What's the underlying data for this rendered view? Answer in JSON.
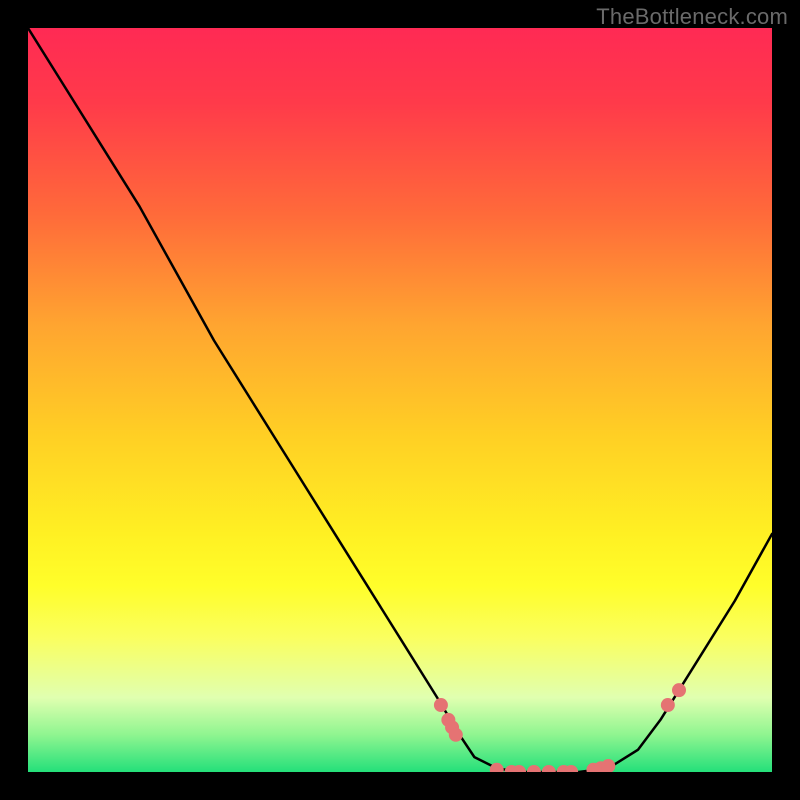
{
  "watermark": "TheBottleneck.com",
  "chart_data": {
    "type": "line",
    "title": "",
    "xlabel": "",
    "ylabel": "",
    "xlim": [
      0,
      100
    ],
    "ylim": [
      0,
      100
    ],
    "series": [
      {
        "name": "bottleneck-curve",
        "x": [
          0,
          5,
          10,
          15,
          20,
          25,
          30,
          35,
          40,
          45,
          50,
          55,
          58,
          60,
          63,
          66,
          70,
          74,
          78,
          82,
          85,
          90,
          95,
          100
        ],
        "y": [
          100,
          92,
          84,
          76,
          67,
          58,
          50,
          42,
          34,
          26,
          18,
          10,
          5,
          2,
          0.5,
          0,
          0,
          0,
          0.5,
          3,
          7,
          15,
          23,
          32
        ],
        "color": "#000000",
        "width": 2.5
      },
      {
        "name": "highlight-dots",
        "type": "scatter",
        "x": [
          55.5,
          56.5,
          57,
          57.5,
          63,
          65,
          66,
          68,
          70,
          72,
          73,
          76,
          77,
          78,
          86,
          87.5
        ],
        "y": [
          9,
          7,
          6,
          5,
          0.3,
          0,
          0,
          0,
          0,
          0,
          0,
          0.3,
          0.5,
          0.8,
          9,
          11
        ],
        "color": "#e57373",
        "radius": 7
      }
    ]
  }
}
